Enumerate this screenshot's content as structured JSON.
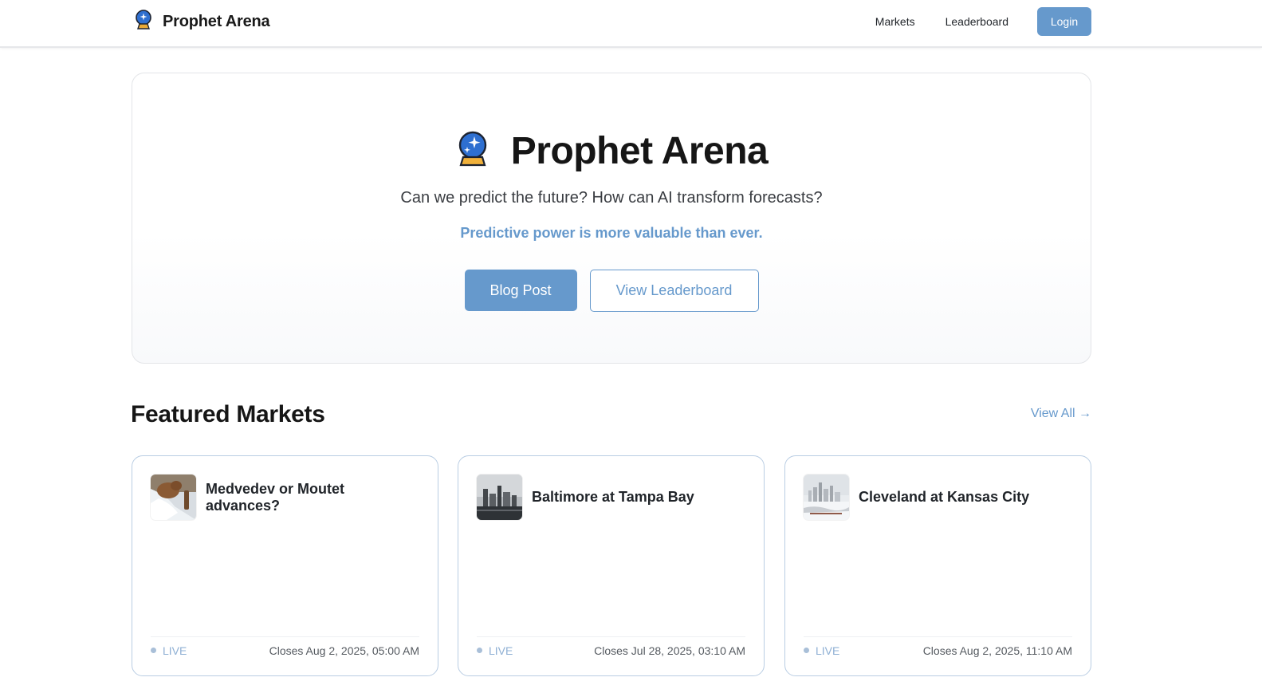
{
  "nav": {
    "brand_icon": "crystal-ball-icon",
    "brand_name": "Prophet Arena",
    "links": [
      "Markets",
      "Leaderboard"
    ],
    "login_label": "Login"
  },
  "hero": {
    "icon": "crystal-ball-icon",
    "title": "Prophet Arena",
    "subtitle": "Can we predict the future? How can AI transform forecasts?",
    "tagline": "Predictive power is more valuable than ever.",
    "primary_button": "Blog Post",
    "secondary_button": "View Leaderboard"
  },
  "featured": {
    "title": "Featured Markets",
    "view_all": "View All →",
    "markets": [
      {
        "title": "Medvedev or Moutet advances?",
        "status": "LIVE",
        "closes": "Closes Aug 2, 2025, 05:00 AM"
      },
      {
        "title": "Baltimore at Tampa Bay",
        "status": "LIVE",
        "closes": "Closes Jul 28, 2025, 03:10 AM"
      },
      {
        "title": "Cleveland at Kansas City",
        "status": "LIVE",
        "closes": "Closes Aug 2, 2025, 11:10 AM"
      }
    ]
  },
  "colors": {
    "accent": "#6699cc",
    "card_border": "#b9cde3",
    "text_dark": "#161616"
  }
}
